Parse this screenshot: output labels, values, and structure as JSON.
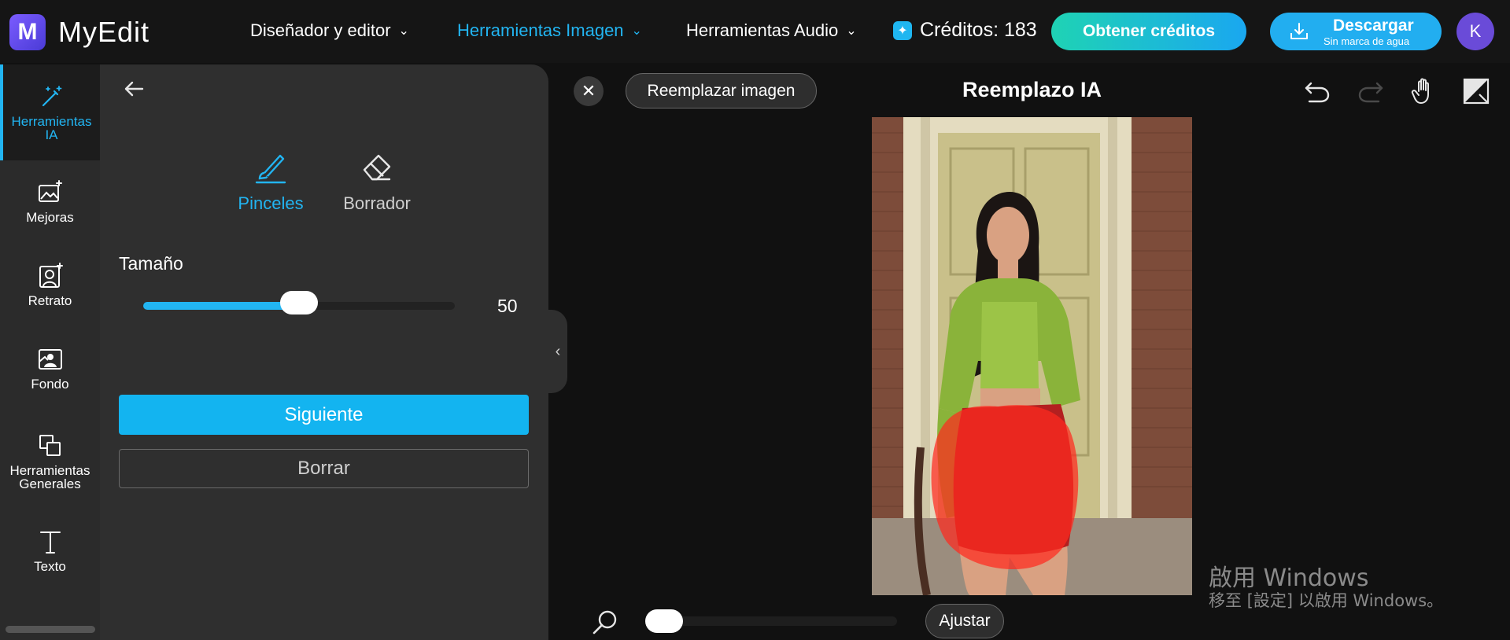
{
  "app": {
    "logo_letter": "M",
    "name": "MyEdit"
  },
  "nav": {
    "designer": "Diseñador y editor",
    "image_tools": "Herramientas Imagen",
    "audio_tools": "Herramientas Audio"
  },
  "credits": {
    "text": "Créditos: 183"
  },
  "buttons": {
    "get_credits": "Obtener créditos",
    "download_main": "Descargar",
    "download_sub": "Sin marca de agua",
    "avatar_letter": "K"
  },
  "sidebar": {
    "items": [
      {
        "label": "Herramientas\nIA",
        "icon": "magic-wand-icon",
        "active": true
      },
      {
        "label": "Mejoras",
        "icon": "image-enhance-icon",
        "active": false
      },
      {
        "label": "Retrato",
        "icon": "portrait-icon",
        "active": false
      },
      {
        "label": "Fondo",
        "icon": "background-icon",
        "active": false
      },
      {
        "label": "Herramientas\nGenerales",
        "icon": "layers-icon",
        "active": false
      },
      {
        "label": "Texto",
        "icon": "text-icon",
        "active": false
      }
    ]
  },
  "panel": {
    "brush_label": "Pinceles",
    "eraser_label": "Borrador",
    "size_label": "Tamaño",
    "size_value": "50",
    "size_fraction": 0.5,
    "next_label": "Siguiente",
    "clear_label": "Borrar"
  },
  "canvas": {
    "replace_label": "Reemplazar imagen",
    "title": "Reemplazo IA",
    "fit_label": "Ajustar",
    "zoom_fraction": 0.0
  },
  "watermark": {
    "line1": "啟用 Windows",
    "line2": "移至 [設定] 以啟用 Windows。"
  },
  "colors": {
    "accent": "#22b5f2",
    "mask": "#ff2a1f",
    "background": "#111111",
    "panel": "#2f2f2f"
  }
}
